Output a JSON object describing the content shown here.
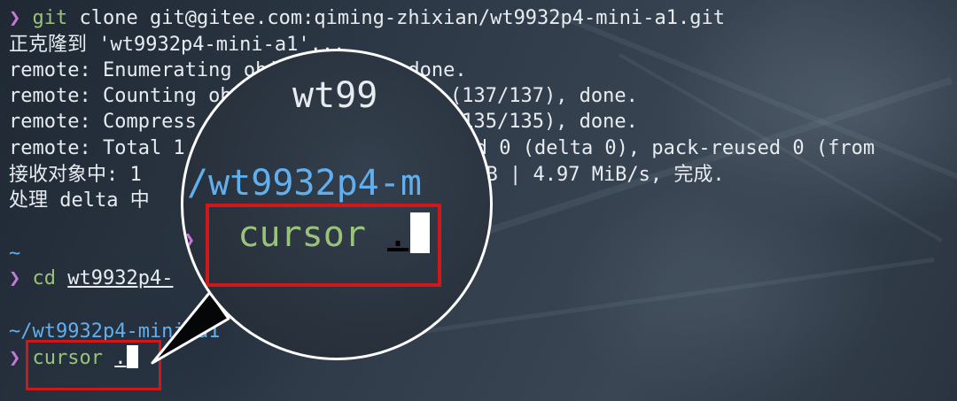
{
  "terminal": {
    "lines": [
      {
        "prompt": "❯",
        "cmd": "git",
        "rest": " clone git@gitee.com:qiming-zhixian/wt9932p4-mini-a1.git"
      },
      {
        "text": "正克隆到 'wt9932p4-mini-a1'..."
      },
      {
        "text": "remote: Enumerating objects: 137, done."
      },
      {
        "text": "remote: Counting ob"
      },
      {
        "text": "remote: Compress"
      },
      {
        "text": "remote: Total 1"
      },
      {
        "text": "接收对象中: 1"
      },
      {
        "text": "处理 delta 中"
      },
      {
        "text": "~"
      },
      {
        "prompt": "❯",
        "cmd": "cd",
        "arg": "wt9932p4-"
      },
      {
        "text": "~/wt9932p4-mini-a1"
      },
      {
        "prompt": "❯",
        "cmd": "cursor",
        "arg": "."
      }
    ],
    "line_tails": {
      "counting": "00% (137/137), done.",
      "compress": "00% (135/135), done.",
      "total": "used 0 (delta 0), pack-reused 0 (from",
      "receiving": "MiB | 4.97 MiB/s, 完成.",
      "delta": ".",
      "cd_arg_hidden": "wt9932p4-mini-a1"
    },
    "faded_text": {
      "counting_overlay": "wt99"
    }
  },
  "magnifier": {
    "path": "/wt9932p4-m",
    "prompt": "❯",
    "command": "cursor",
    "arg": "."
  },
  "colors": {
    "prompt": "#c678dd",
    "command": "#98c379",
    "dir": "#61afef",
    "highlight_box": "#d0181b"
  }
}
